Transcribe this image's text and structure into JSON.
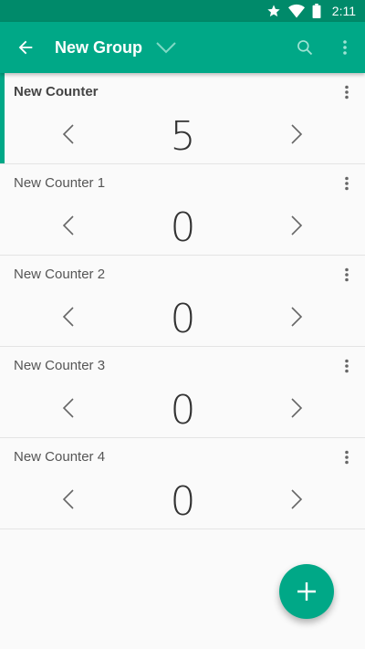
{
  "status_bar": {
    "time": "2:11",
    "icons": [
      "star-icon",
      "wifi-icon",
      "battery-icon"
    ]
  },
  "app_bar": {
    "title": "New Group",
    "icons": [
      "back-arrow-icon",
      "chevron-down-icon",
      "search-icon",
      "more-vert-icon"
    ]
  },
  "counters": [
    {
      "name": "New Counter",
      "value": "5",
      "selected": true
    },
    {
      "name": "New Counter 1",
      "value": "0",
      "selected": false
    },
    {
      "name": "New Counter 2",
      "value": "0",
      "selected": false
    },
    {
      "name": "New Counter 3",
      "value": "0",
      "selected": false
    },
    {
      "name": "New Counter 4",
      "value": "0",
      "selected": false
    }
  ],
  "fab": {
    "icon": "plus-icon"
  },
  "colors": {
    "status_bar": "#008a6a",
    "app_bar": "#00a887",
    "accent": "#00a887",
    "background": "#fafafa"
  }
}
